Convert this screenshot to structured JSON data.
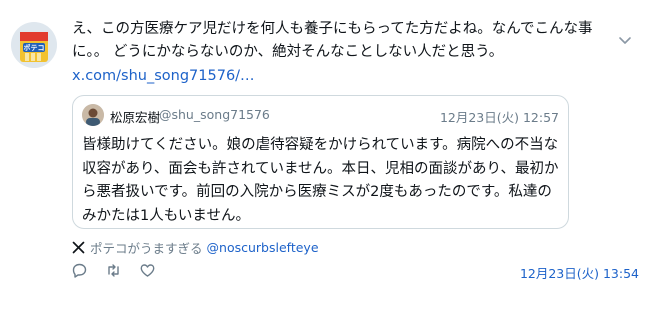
{
  "post": {
    "text": "え、この方医療ケア児だけを何人も養子にもらってた方だよね。なんでこんな事に。。 どうにかならないのか、絶対そんなことしない人だと思う。",
    "link": "x.com/shu_song71576/…",
    "avatar_label": "ポテコ",
    "timestamp": "12月23日(火) 13:54"
  },
  "quote": {
    "name": "松原宏樹",
    "handle": "@shu_song71576",
    "time": "12月23日(火) 12:57",
    "text": "皆様助けてください。娘の虐待容疑をかけられています。病院への不当な収容があり、面会も許されていません。本日、児相の面談があり、最初から悪者扱いです。前回の入院から医療ミスが2度もあったのです。私達のみかたは1人もいません。"
  },
  "attribution": {
    "text": "ポテコがうますぎる",
    "handle": "@noscurbslefteye"
  },
  "icons": {
    "chevron": "chevron-down-icon",
    "x_logo": "x-logo-icon",
    "reply": "reply-icon",
    "repost": "repost-icon",
    "like": "heart-icon"
  },
  "colors": {
    "text": "#0f1419",
    "muted": "#6b7c8a",
    "link": "#1d62c9",
    "border": "#cfd9de"
  }
}
